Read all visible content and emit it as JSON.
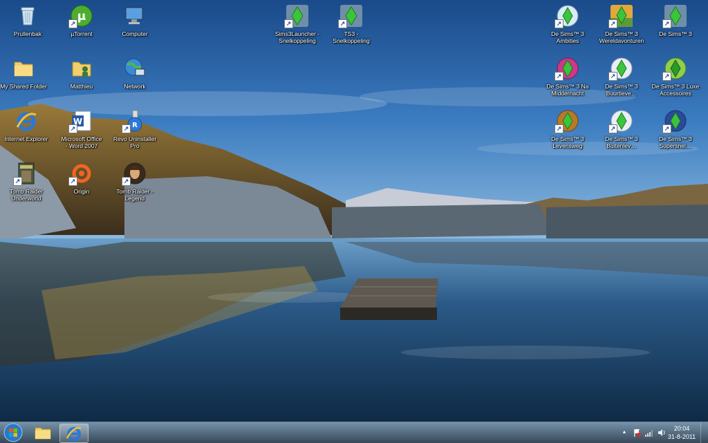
{
  "desktop": {
    "icons": [
      {
        "label": "Prullenbak",
        "icon": "recycle-bin-icon"
      },
      {
        "label": "µTorrent",
        "icon": "utorrent-icon"
      },
      {
        "label": "Computer",
        "icon": "computer-icon"
      },
      {
        "label": "Sims3Launcher -\nSnelkoppeling",
        "icon": "sims-plumbob-icon"
      },
      {
        "label": "TS3 - Snelkoppeling",
        "icon": "sims-plumbob-icon"
      },
      {
        "label": "De Sims™ 3\nAmbities",
        "icon": "sims-ambitions-icon"
      },
      {
        "label": "De Sims™ 3\nWereldavonturen",
        "icon": "sims-world-adventures-icon"
      },
      {
        "label": "De Sims™ 3",
        "icon": "sims-plumbob-icon"
      },
      {
        "label": "My Shared Folder",
        "icon": "folder-icon"
      },
      {
        "label": "Matthieu",
        "icon": "user-folder-icon"
      },
      {
        "label": "Network",
        "icon": "network-icon"
      },
      {
        "label": "De Sims™ 3 Na\nMiddernacht",
        "icon": "sims-late-night-icon"
      },
      {
        "label": "De Sims™ 3\nBuurtleve…",
        "icon": "sims-generations-icon"
      },
      {
        "label": "De Sims™ 3 Luxe\nAccessoires",
        "icon": "sims-luxe-icon"
      },
      {
        "label": "Internet Explorer",
        "icon": "internet-explorer-icon"
      },
      {
        "label": "Microsoft Office\n- Word 2007",
        "icon": "word-icon"
      },
      {
        "label": "Revo Uninstaller Pro",
        "icon": "revo-uninstaller-icon"
      },
      {
        "label": "De Sims™ 3\nLevensweg",
        "icon": "sims-generations-icon"
      },
      {
        "label": "De Sims™ 3\nBuitenlev…",
        "icon": "sims-outdoor-icon"
      },
      {
        "label": "De Sims™ 3\nSupersnel…",
        "icon": "sims-fast-lane-icon"
      },
      {
        "label": "Tomb Raider\nUnderworld",
        "icon": "tomb-raider-underworld-icon"
      },
      {
        "label": "Origin",
        "icon": "origin-icon"
      },
      {
        "label": "Tomb Raider -\nLegend",
        "icon": "tomb-raider-legend-icon"
      }
    ]
  },
  "taskbar": {
    "pinned": [
      {
        "icon": "windows-explorer-icon"
      },
      {
        "icon": "internet-explorer-icon"
      }
    ],
    "tray": {
      "up_arrow": "▲",
      "clock_time": "20:04",
      "clock_date": "31-8-2011"
    }
  },
  "colors": {
    "sims_green": "#3cc43c",
    "taskbar": "#1e3a52"
  }
}
